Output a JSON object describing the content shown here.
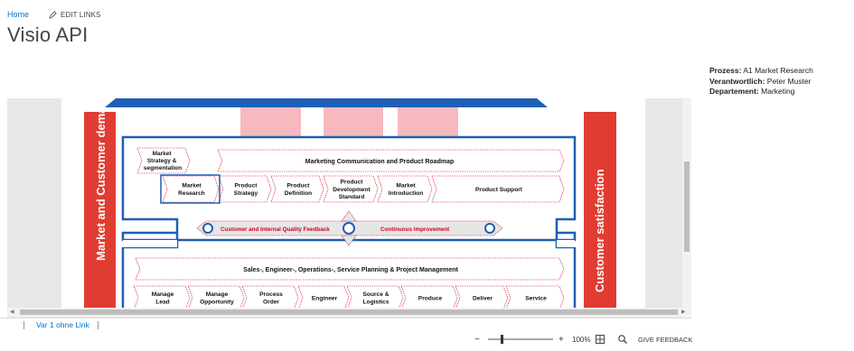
{
  "nav": {
    "home": "Home",
    "edit_links": "EDIT LINKS"
  },
  "page": {
    "title": "Visio API"
  },
  "meta": {
    "prozess_label": "Prozess:",
    "prozess_value": "A1 Market Research",
    "verantwortlich_label": "Verantwortlich:",
    "verantwortlich_value": "Peter Muster",
    "departement_label": "Departement:",
    "departement_value": "Marketing"
  },
  "diagram": {
    "left_banner": "Market and Customer demands",
    "right_banner": "Customer satisfaction",
    "strategy_box": [
      "Market",
      "Strategy &",
      "segmentation"
    ],
    "marketing_comm": "Marketing Communication and Product Roadmap",
    "row1": [
      [
        "Market",
        "Research"
      ],
      [
        "Product",
        "Strategy"
      ],
      [
        "Product",
        "Definition"
      ],
      [
        "Product",
        "Development",
        "Standard"
      ],
      [
        "Market",
        "Introduction"
      ],
      [
        "Product Support"
      ]
    ],
    "quality_feedback": "Customer and Internal Quality Feedback",
    "continuous_improvement": "Continuous Improvement",
    "sales_banner": "Sales-, Engineer-,  Operations-, Service Planning & Project Management",
    "row2": [
      [
        "Manage",
        "Lead"
      ],
      [
        "Manage",
        "Opportunity"
      ],
      [
        "Process",
        "Order"
      ],
      [
        "Engineer"
      ],
      [
        "Source &",
        "Logistics"
      ],
      [
        "Produce"
      ],
      [
        "Deliver"
      ],
      [
        "Service"
      ]
    ]
  },
  "sheets": {
    "tab1": "Var 1 ohne Link"
  },
  "status": {
    "minus": "−",
    "plus": "+",
    "zoom": "100%",
    "feedback": "GIVE FEEDBACK"
  },
  "colors": {
    "red_banner": "#e03c31",
    "blue_frame": "#1f5fb5",
    "pink_block": "#f7b9bd",
    "link_blue": "#0072c6"
  }
}
